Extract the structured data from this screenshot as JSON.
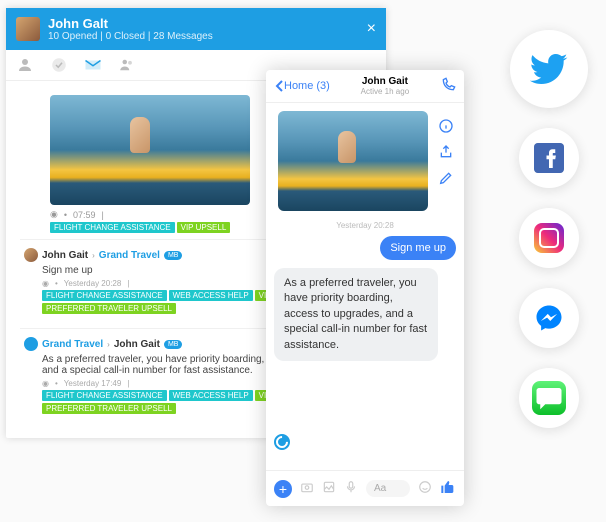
{
  "agent": {
    "name": "John Galt",
    "stats": "10 Opened | 0 Closed | 28 Messages",
    "image_meta": "07:59",
    "tags": [
      {
        "label": "FLIGHT CHANGE ASSISTANCE",
        "cls": "tc"
      },
      {
        "label": "VIP UPSELL",
        "cls": "tg"
      }
    ],
    "threads": [
      {
        "from": "John Gait",
        "to": "Grand Travel",
        "badge": "MB",
        "text": "Sign me up",
        "time": "Yesterday 20:28",
        "tags": [
          {
            "label": "FLIGHT CHANGE ASSISTANCE",
            "cls": "tc"
          },
          {
            "label": "WEB ACCESS HELP",
            "cls": "tc"
          },
          {
            "label": "VIP UPSELL",
            "cls": "tg"
          },
          {
            "label": "PREFERRED TRAVELER UPSELL",
            "cls": "tg"
          }
        ]
      },
      {
        "from": "Grand Travel",
        "to": "John Gait",
        "badge": "MB",
        "swap": true,
        "text": "As a preferred traveler, you have priority boarding, access to upgrades, and a special call-in number for fast assistance.",
        "time": "Yesterday 17:49",
        "tags": [
          {
            "label": "FLIGHT CHANGE ASSISTANCE",
            "cls": "tc"
          },
          {
            "label": "WEB ACCESS HELP",
            "cls": "tc"
          },
          {
            "label": "VIP UPSELL",
            "cls": "tg"
          },
          {
            "label": "PREFERRED TRAVELER UPSELL",
            "cls": "tg"
          }
        ]
      }
    ]
  },
  "mobile": {
    "back": "Home (3)",
    "title": "John Gait",
    "subtitle": "Active 1h ago",
    "timestamp": "Yesterday 20:28",
    "user_msg": "Sign me up",
    "agent_msg": "As a preferred traveler, you have priority boarding, access to upgrades, and a special call-in number for fast assistance.",
    "placeholder": "Aa"
  }
}
